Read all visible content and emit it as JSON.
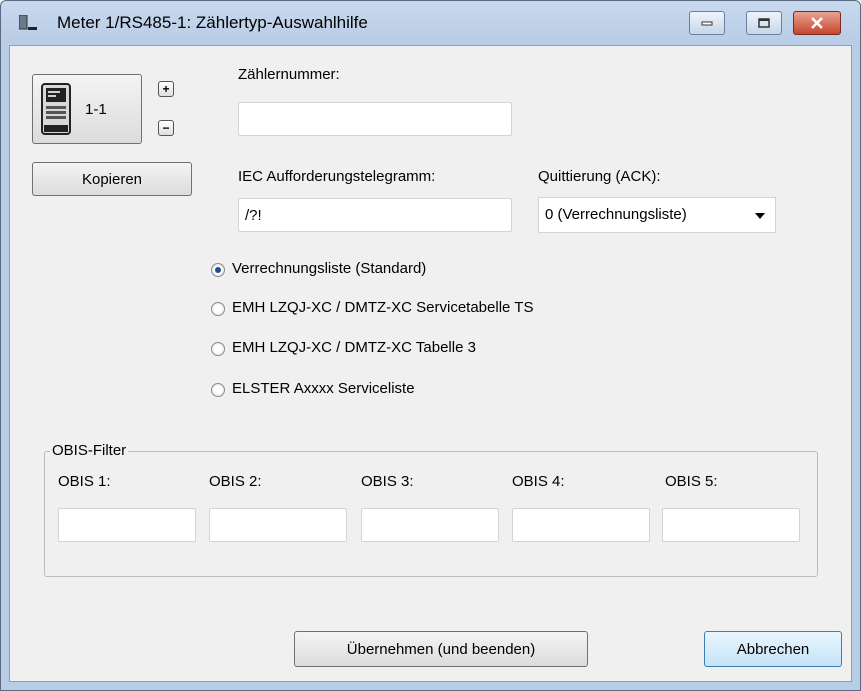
{
  "window": {
    "title": "Meter 1/RS485-1: Zählertyp-Auswahlhilfe",
    "controls": [
      "minimize-icon",
      "maximize-icon",
      "close-icon"
    ]
  },
  "meter": {
    "id_label": "1-1",
    "icon": "meter-icon"
  },
  "buttons": {
    "plus": "+",
    "minus": "−",
    "copy": "Kopieren",
    "apply": "Übernehmen (und beenden)",
    "cancel": "Abbrechen"
  },
  "fields": {
    "meter_number_label": "Zählernummer:",
    "meter_number_value": "",
    "iec_label": "IEC Aufforderungstelegramm:",
    "iec_value": "/?!",
    "ack_label": "Quittierung (ACK):",
    "ack_value": "0 (Verrechnungsliste)"
  },
  "radios": [
    {
      "label": "Verrechnungsliste (Standard)",
      "checked": true
    },
    {
      "label": "EMH LZQJ-XC / DMTZ-XC Servicetabelle TS",
      "checked": false
    },
    {
      "label": "EMH LZQJ-XC / DMTZ-XC Tabelle 3",
      "checked": false
    },
    {
      "label": "ELSTER Axxxx Serviceliste",
      "checked": false
    }
  ],
  "obis": {
    "group_label": "OBIS-Filter",
    "items": [
      {
        "label": "OBIS 1:",
        "value": ""
      },
      {
        "label": "OBIS 2:",
        "value": ""
      },
      {
        "label": "OBIS 3:",
        "value": ""
      },
      {
        "label": "OBIS 4:",
        "value": ""
      },
      {
        "label": "OBIS 5:",
        "value": ""
      }
    ]
  },
  "colors": {
    "titlebar": "#c9d9ee",
    "close_button": "#c7452c",
    "radio_dot": "#1d4f8f",
    "focus_button_border": "#3c7fb1"
  }
}
